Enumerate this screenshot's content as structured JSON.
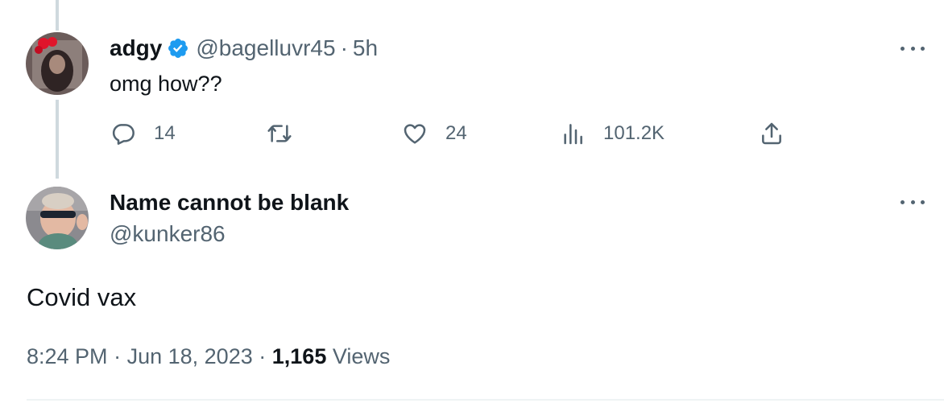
{
  "reply_tweet": {
    "display_name": "adgy",
    "handle": "@bagelluvr45",
    "separator": "·",
    "time_ago": "5h",
    "text": "omg how??",
    "verified_icon": "verified-badge-icon",
    "actions": {
      "replies": "14",
      "retweets": "",
      "likes": "24",
      "views": "101.2K"
    }
  },
  "main_tweet": {
    "display_name": "Name cannot be blank",
    "handle": "@kunker86",
    "text": "Covid vax",
    "time": "8:24 PM",
    "separator": "·",
    "date": "Jun 18, 2023",
    "view_count": "1,165",
    "views_label": "Views"
  },
  "colors": {
    "accent": "#1d9bf0",
    "secondary_text": "#536471",
    "primary_text": "#0f1419",
    "thread_line": "#cfd9de"
  }
}
